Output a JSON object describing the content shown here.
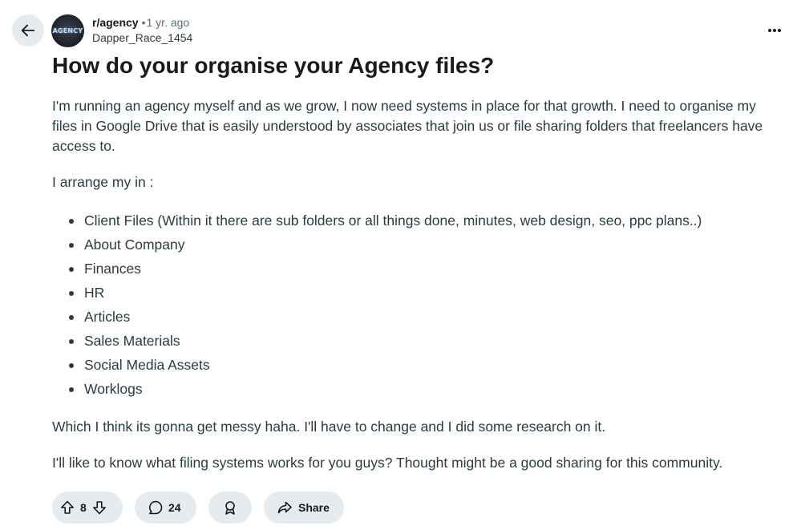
{
  "header": {
    "subreddit": "r/agency",
    "separator": "•",
    "time": "1 yr. ago",
    "author": "Dapper_Race_1454",
    "avatar_text": "AGENCY"
  },
  "post": {
    "title": "How do your organise your Agency files?",
    "intro": "I'm running an agency myself and as we grow, I now need systems in place for that growth. I need to organise my files in Google Drive that is easily understood by associates that join us or file sharing folders that freelancers have access to.",
    "lead": "I arrange my in :",
    "items": [
      "Client Files (Within it there are sub folders or all things done, minutes, web design, seo, ppc plans..)",
      "About Company",
      "Finances",
      "HR",
      "Articles",
      "Sales Materials",
      "Social Media Assets",
      "Worklogs"
    ],
    "para2": "Which I think its gonna get messy haha. I'll have to change and I did some research on it.",
    "para3": "I'll like to know what filing systems works for you guys? Thought might be a good sharing for this community."
  },
  "actions": {
    "vote_count": "8",
    "comment_count": "24",
    "share_label": "Share"
  },
  "icons": {
    "back": "arrow-left-icon",
    "more": "ellipsis-horizontal-icon",
    "upvote": "arrow-up-icon",
    "downvote": "arrow-down-icon",
    "comment": "speech-bubble-icon",
    "award": "award-ribbon-icon",
    "share": "share-arrow-icon"
  },
  "colors": {
    "pill_bg": "#e5ebee",
    "text_primary": "#1a1a1b",
    "text_body": "#2a3c42",
    "text_muted": "#576f76"
  }
}
